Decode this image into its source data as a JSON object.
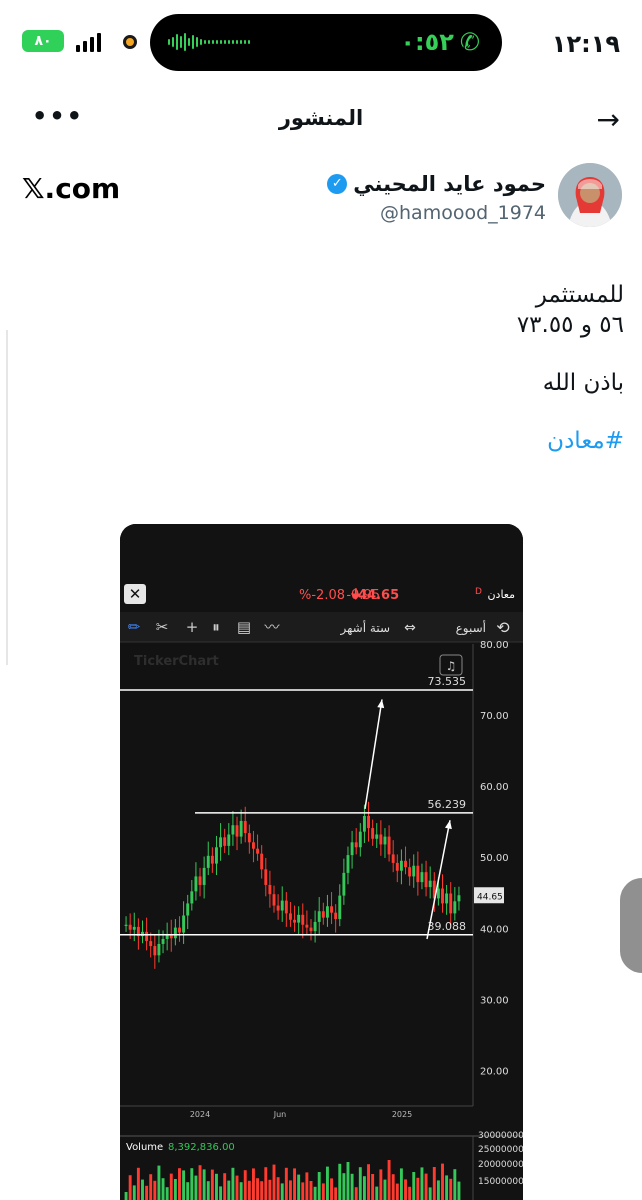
{
  "status": {
    "time": "١٢:١٩",
    "call_timer": "٠:٥٢",
    "battery": "٨٠"
  },
  "header": {
    "title": "المنشور",
    "more": "•••"
  },
  "author": {
    "name": "حمود عايد المحيني",
    "handle": "@hamoood_1974",
    "site": "𝕏.com"
  },
  "post": {
    "line1": "للمستثمر",
    "line2": "٥٦ و ٧٣.٥٥",
    "line3": "باذن الله",
    "hashtag": "#معادن"
  },
  "chart_data": {
    "type": "candlestick",
    "header": {
      "change_pct": "%-2.08",
      "change": "-0.95",
      "price": "44.65",
      "symbol": "معادن",
      "period_flag": "D"
    },
    "toolbar": {
      "range": "ستة أشهر",
      "interval": "أسبوع"
    },
    "watermark": "TickerChart",
    "y_ticks": [
      "80.00",
      "70.00",
      "60.00",
      "50.00",
      "40.00",
      "30.00",
      "20.00"
    ],
    "ylim": [
      15,
      80
    ],
    "x_ticks": [
      "2024",
      "Jun",
      "2025"
    ],
    "levels": [
      {
        "label": "73.535",
        "value": 73.535
      },
      {
        "label": "56.239",
        "value": 56.239
      },
      {
        "label": "39.088",
        "value": 39.088
      }
    ],
    "last_price_tag": "44.65",
    "candles": [
      40.5,
      39.8,
      40.2,
      38.9,
      39.5,
      38.2,
      37.5,
      36.2,
      37.8,
      38.5,
      39.2,
      38.6,
      40.1,
      39.4,
      41.8,
      43.5,
      45.2,
      47.3,
      46.1,
      48.5,
      50.2,
      49.1,
      51.4,
      52.8,
      51.6,
      53.2,
      54.5,
      52.9,
      55.1,
      53.4,
      52.1,
      51.2,
      50.5,
      48.3,
      46.1,
      44.8,
      43.2,
      42.5,
      43.9,
      42.1,
      41.2,
      40.8,
      41.9,
      40.5,
      40.1,
      39.6,
      40.9,
      42.4,
      41.5,
      43.1,
      42.2,
      41.3,
      44.6,
      47.8,
      50.3,
      52.1,
      51.4,
      53.6,
      55.8,
      54.1,
      52.6,
      53.2,
      51.8,
      52.9,
      50.4,
      49.2,
      48.1,
      49.5,
      48.6,
      47.3,
      48.8,
      46.5,
      47.9,
      45.8,
      46.7,
      44.2,
      45.6,
      43.5,
      44.9,
      42.1,
      43.8,
      44.65
    ],
    "volume": {
      "label": "Volume",
      "value": "8,392,836.00",
      "y_ticks": [
        "30000000",
        "25000000",
        "20000000",
        "15000000"
      ]
    }
  }
}
